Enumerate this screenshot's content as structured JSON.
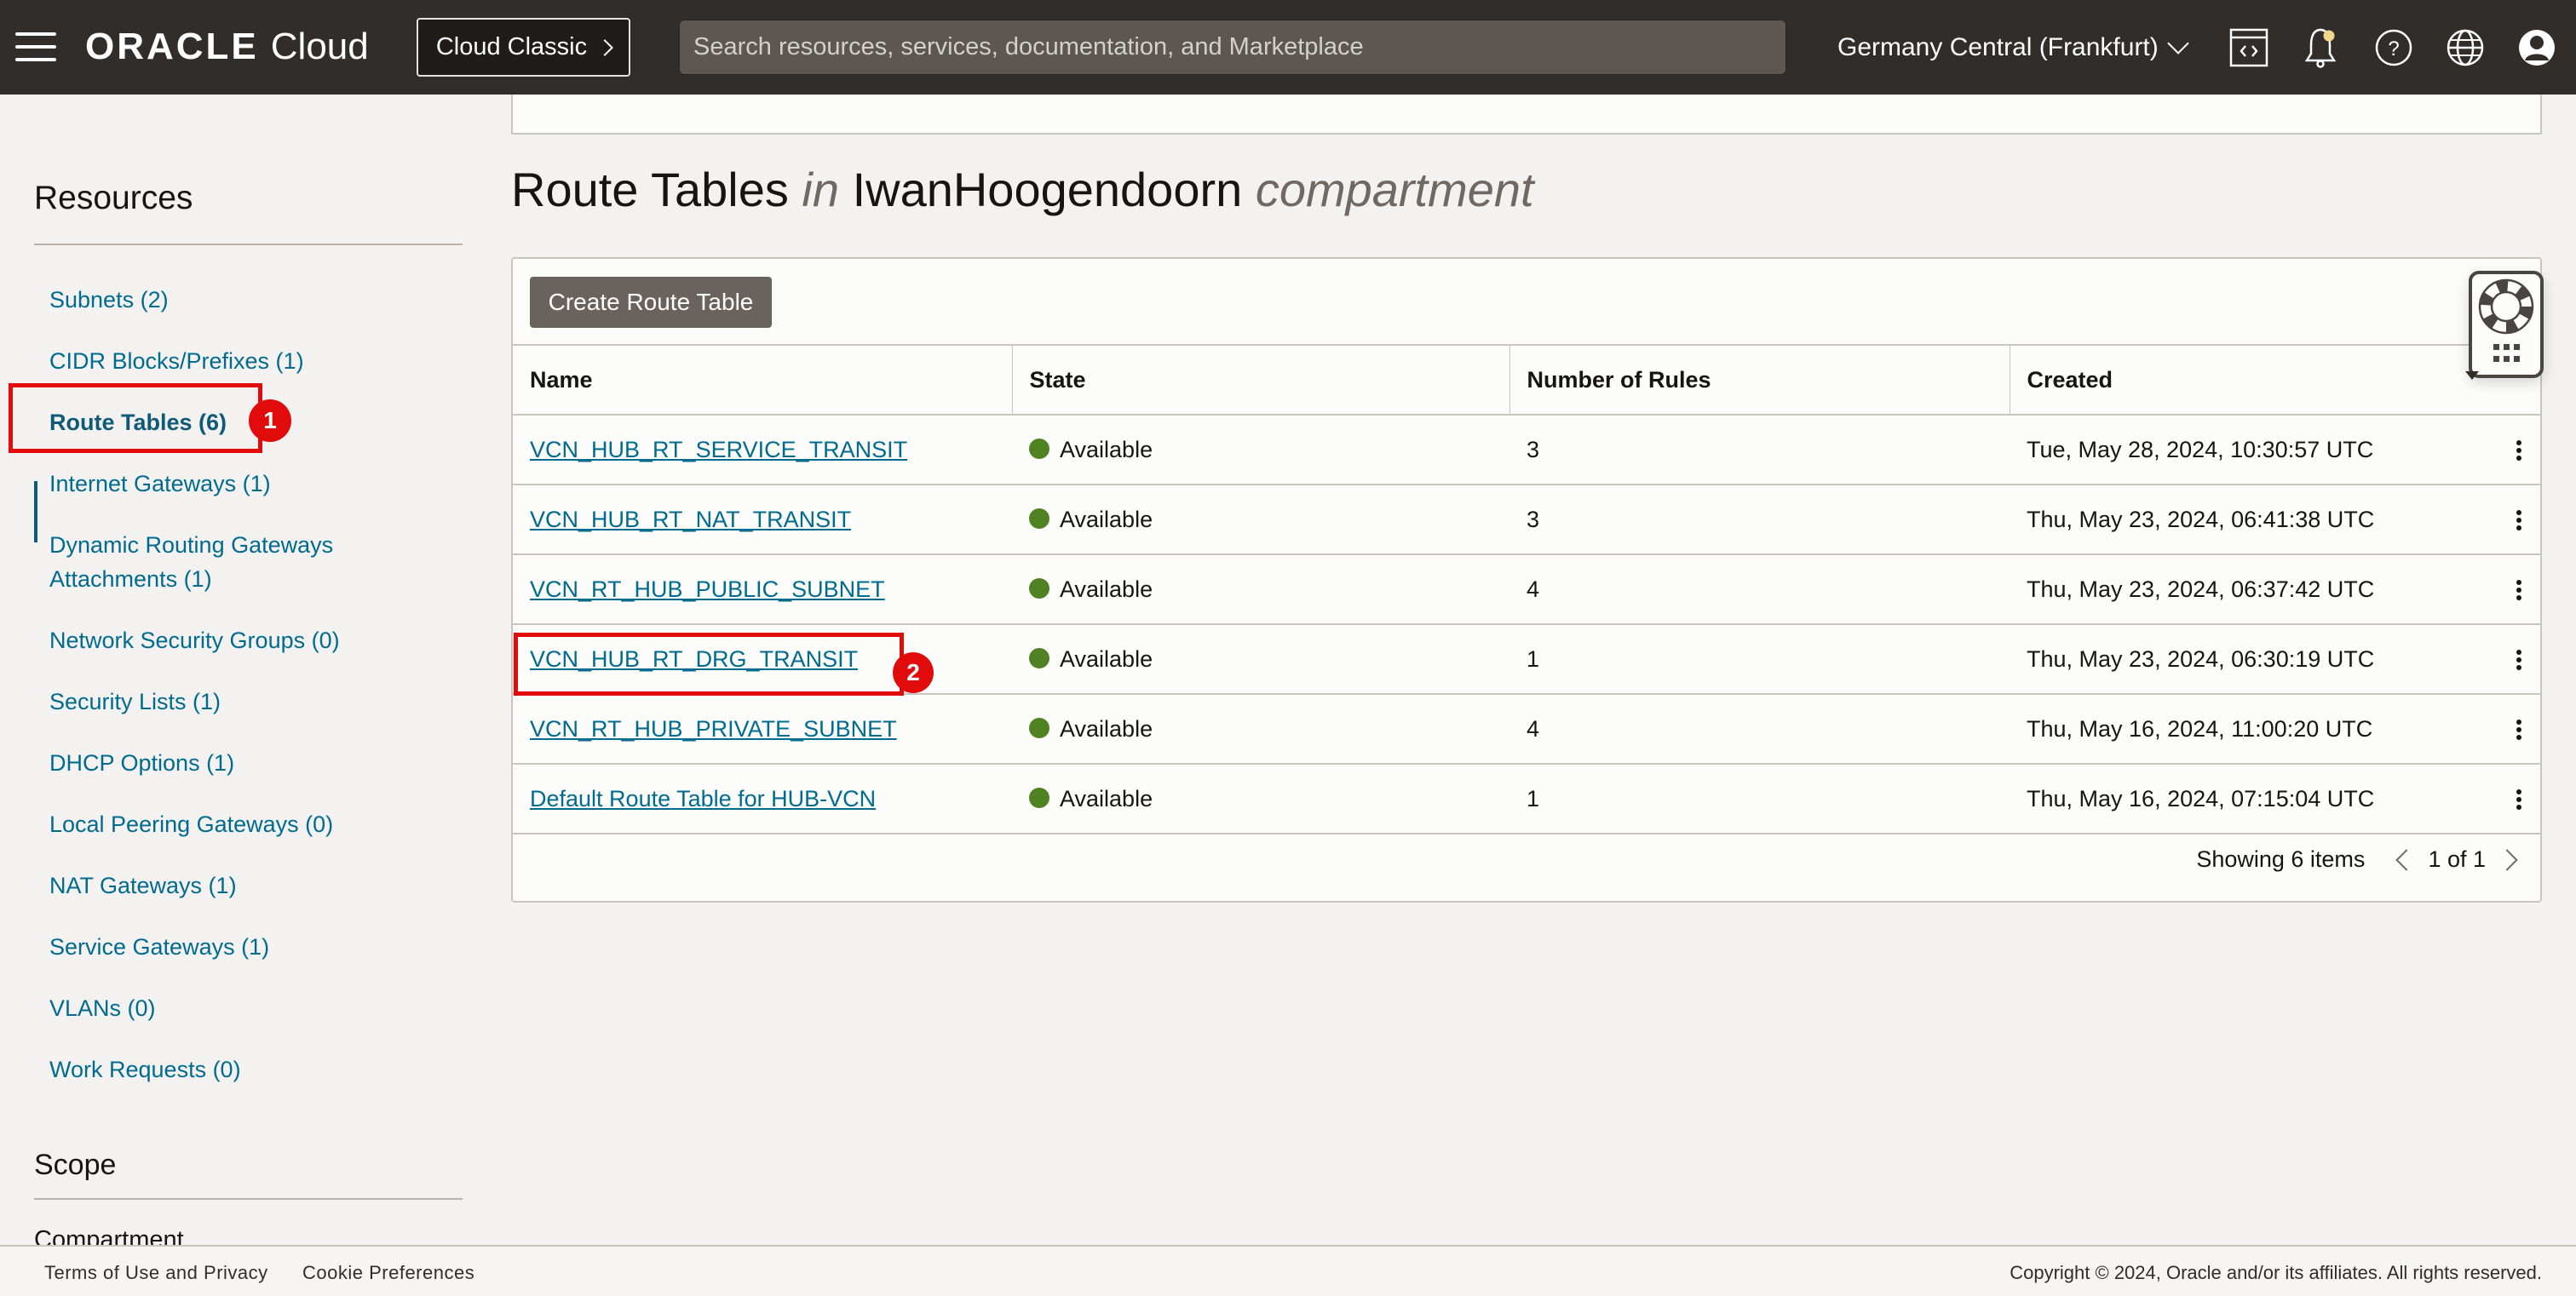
{
  "header": {
    "logo_brand": "ORACLE",
    "logo_product": "Cloud",
    "classic_button": "Cloud Classic",
    "search_placeholder": "Search resources, services, documentation, and Marketplace",
    "region": "Germany Central (Frankfurt)",
    "icons": [
      "code-editor-icon",
      "notifications-bell-icon",
      "help-icon",
      "language-globe-icon",
      "user-profile-icon"
    ]
  },
  "sidebar": {
    "resources_title": "Resources",
    "items": [
      {
        "label": "Subnets (2)",
        "active": false
      },
      {
        "label": "CIDR Blocks/Prefixes (1)",
        "active": false
      },
      {
        "label": "Route Tables (6)",
        "active": true
      },
      {
        "label": "Internet Gateways (1)",
        "active": false
      },
      {
        "label": "Dynamic Routing Gateways",
        "label2": "Attachments (1)",
        "active": false
      },
      {
        "label": "Network Security Groups (0)",
        "active": false
      },
      {
        "label": "Security Lists (1)",
        "active": false
      },
      {
        "label": "DHCP Options (1)",
        "active": false
      },
      {
        "label": "Local Peering Gateways (0)",
        "active": false
      },
      {
        "label": "NAT Gateways (1)",
        "active": false
      },
      {
        "label": "Service Gateways (1)",
        "active": false
      },
      {
        "label": "VLANs (0)",
        "active": false
      },
      {
        "label": "Work Requests (0)",
        "active": false
      }
    ],
    "scope_title": "Scope",
    "compartment_label": "Compartment"
  },
  "main": {
    "title_resource": "Route Tables",
    "title_in": "in",
    "title_compartment_name": "IwanHoogendoorn",
    "title_compartment_word": "compartment",
    "create_button": "Create Route Table",
    "columns": [
      "Name",
      "State",
      "Number of Rules",
      "Created"
    ],
    "rows": [
      {
        "name": "VCN_HUB_RT_SERVICE_TRANSIT",
        "state": "Available",
        "rules": "3",
        "created": "Tue, May 28, 2024, 10:30:57 UTC"
      },
      {
        "name": "VCN_HUB_RT_NAT_TRANSIT",
        "state": "Available",
        "rules": "3",
        "created": "Thu, May 23, 2024, 06:41:38 UTC"
      },
      {
        "name": "VCN_RT_HUB_PUBLIC_SUBNET",
        "state": "Available",
        "rules": "4",
        "created": "Thu, May 23, 2024, 06:37:42 UTC"
      },
      {
        "name": "VCN_HUB_RT_DRG_TRANSIT",
        "state": "Available",
        "rules": "1",
        "created": "Thu, May 23, 2024, 06:30:19 UTC"
      },
      {
        "name": "VCN_RT_HUB_PRIVATE_SUBNET",
        "state": "Available",
        "rules": "4",
        "created": "Thu, May 16, 2024, 11:00:20 UTC"
      },
      {
        "name": "Default Route Table for HUB-VCN",
        "state": "Available",
        "rules": "1",
        "created": "Thu, May 16, 2024, 07:15:04 UTC"
      }
    ],
    "status_color": "#508223",
    "pagination": {
      "showing": "Showing 6 items",
      "page": "1 of 1"
    }
  },
  "annotations": [
    {
      "number": "1",
      "target": "Route Tables (6)"
    },
    {
      "number": "2",
      "target": "VCN_HUB_RT_DRG_TRANSIT"
    }
  ],
  "footer": {
    "terms": "Terms of Use and Privacy",
    "cookies": "Cookie Preferences",
    "copyright": "Copyright © 2024, Oracle and/or its affiliates. All rights reserved."
  }
}
